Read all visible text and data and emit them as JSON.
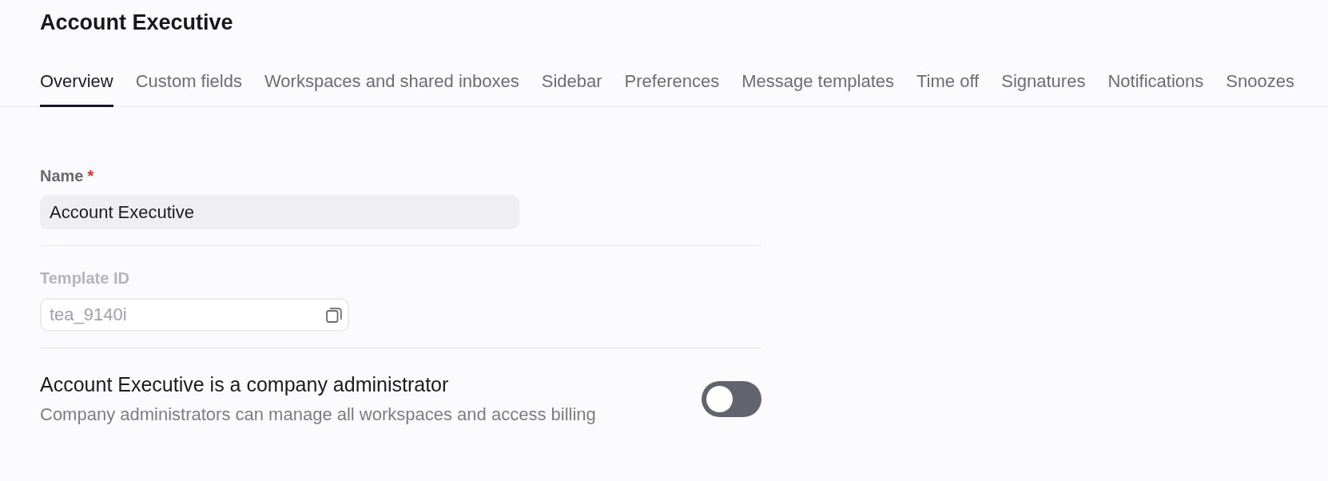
{
  "page_title": "Account Executive",
  "tabs": [
    {
      "label": "Overview",
      "selected": true
    },
    {
      "label": "Custom fields",
      "selected": false
    },
    {
      "label": "Workspaces and shared inboxes",
      "selected": false
    },
    {
      "label": "Sidebar",
      "selected": false
    },
    {
      "label": "Preferences",
      "selected": false
    },
    {
      "label": "Message templates",
      "selected": false
    },
    {
      "label": "Time off",
      "selected": false
    },
    {
      "label": "Signatures",
      "selected": false
    },
    {
      "label": "Notifications",
      "selected": false
    },
    {
      "label": "Snoozes",
      "selected": false
    }
  ],
  "form": {
    "name": {
      "label": "Name",
      "required_mark": "*",
      "value": "Account Executive"
    },
    "template_id": {
      "label": "Template ID",
      "value": "tea_9140i",
      "disabled": true
    },
    "admin_setting": {
      "title": "Account Executive is a company administrator",
      "description": "Company administrators can manage all workspaces and access billing",
      "on": false
    }
  }
}
